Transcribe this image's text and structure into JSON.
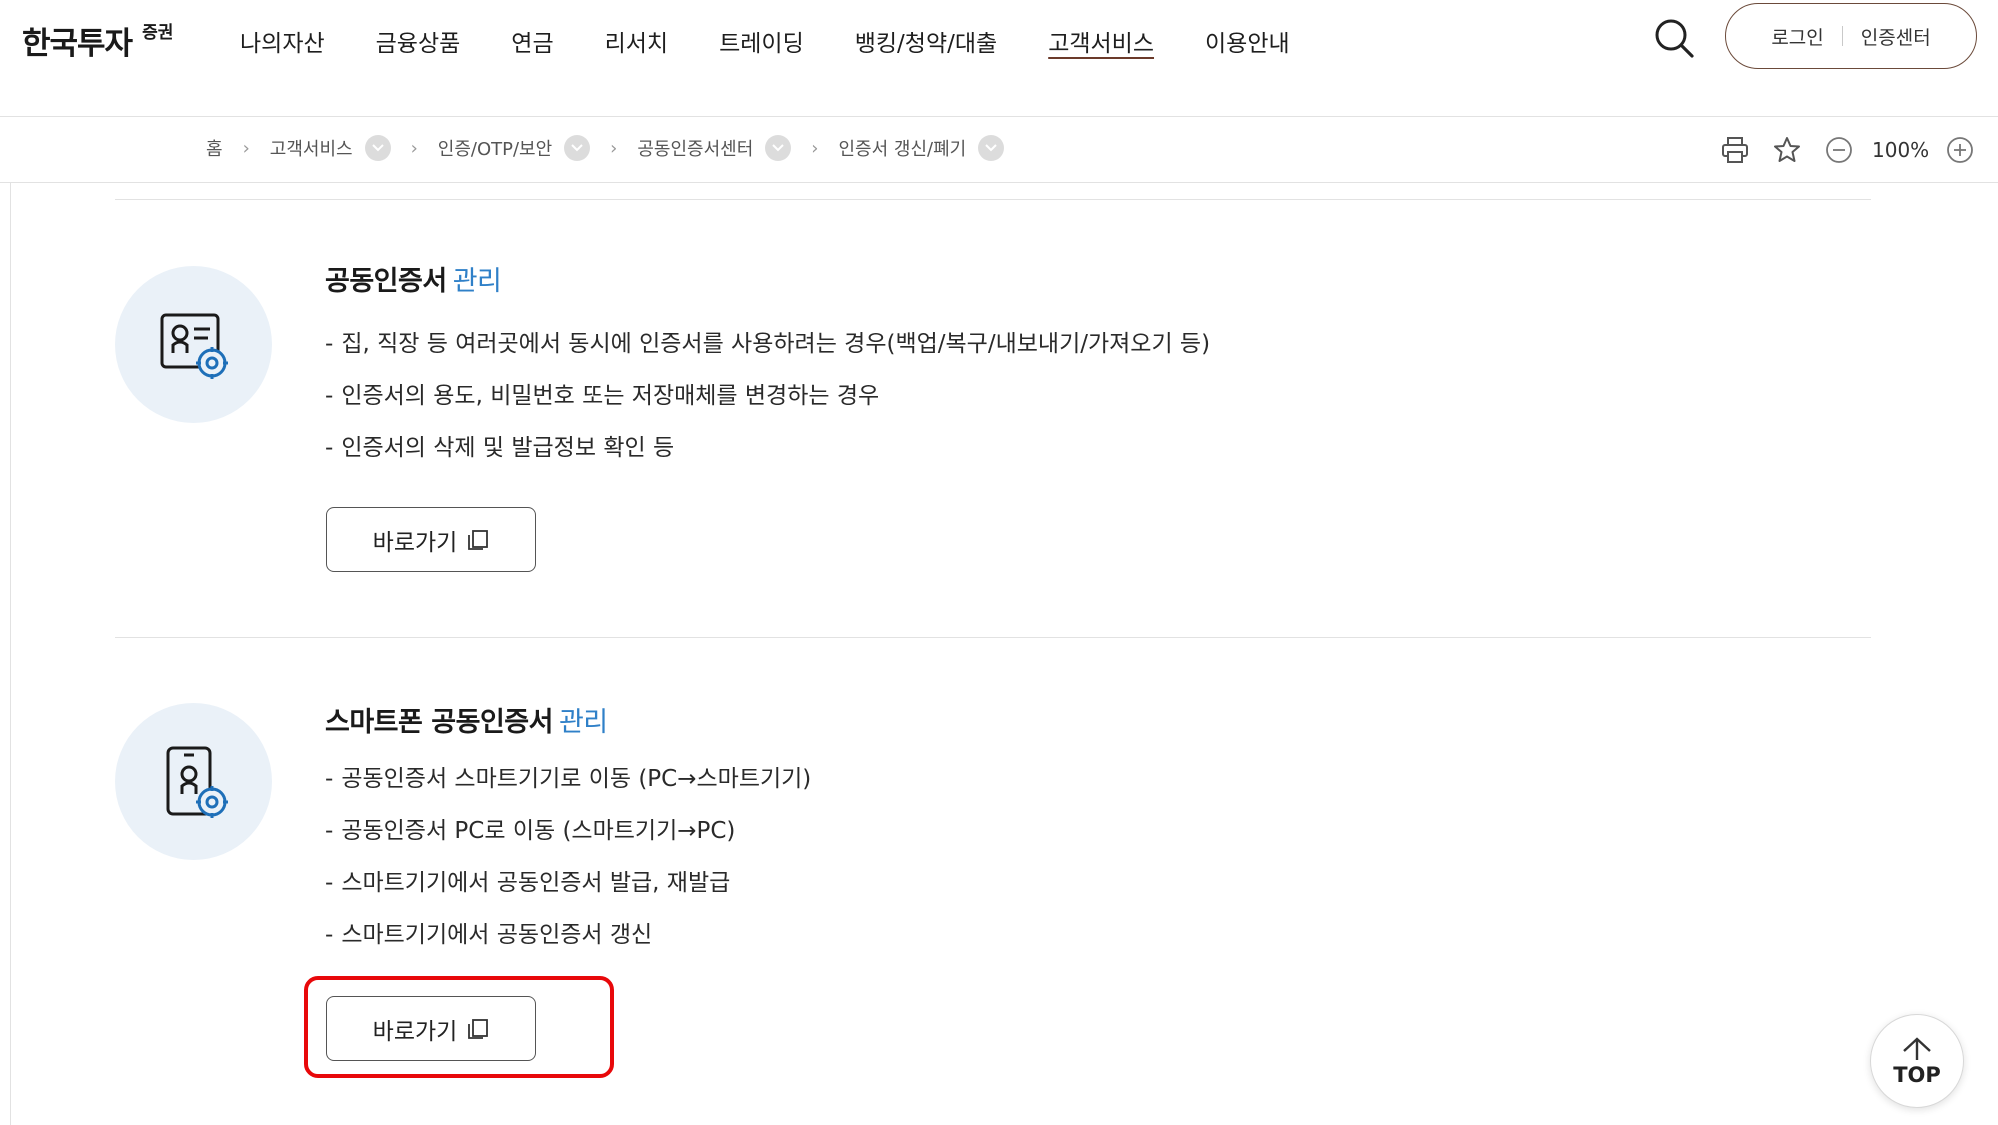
{
  "header": {
    "logo_main": "한국투자",
    "logo_sub": "증권",
    "nav": [
      {
        "label": "나의자산"
      },
      {
        "label": "금융상품"
      },
      {
        "label": "연금"
      },
      {
        "label": "리서치"
      },
      {
        "label": "트레이딩"
      },
      {
        "label": "뱅킹/청약/대출"
      },
      {
        "label": "고객서비스",
        "active": true
      },
      {
        "label": "이용안내"
      }
    ],
    "search_icon": "search-icon",
    "login_label": "로그인",
    "cert_center_label": "인증센터",
    "accent_color": "#6b4a3a"
  },
  "breadcrumb": {
    "home": "홈",
    "items": [
      "고객서비스",
      "인증/OTP/보안",
      "공동인증서센터",
      "인증서 갱신/폐기"
    ]
  },
  "tools": {
    "icons": [
      "print-icon",
      "star-icon",
      "zoom-out-icon",
      "zoom-in-icon"
    ],
    "zoom_level": "100%"
  },
  "sections": [
    {
      "title": "공동인증서",
      "title_accent": "관리",
      "icon": "certificate-gear-icon",
      "bullets": [
        "집, 직장 등 여러곳에서 동시에 인증서를 사용하려는 경우(백업/복구/내보내기/가져오기 등)",
        "인증서의 용도, 비밀번호 또는 저장매체를 변경하는 경우",
        "인증서의 삭제 및 발급정보 확인 등"
      ],
      "button": "바로가기"
    },
    {
      "title": "스마트폰 공동인증서",
      "title_accent": "관리",
      "icon": "smartphone-certificate-icon",
      "bullets": [
        "공동인증서 스마트기기로 이동 (PC→스마트기기)",
        "공동인증서 PC로 이동 (스마트기기→PC)",
        "스마트기기에서 공동인증서 발급, 재발급",
        "스마트기기에서 공동인증서 갱신"
      ],
      "button": "바로가기"
    }
  ],
  "top_button": "TOP",
  "colors": {
    "accent_blue": "#2f80c8",
    "icon_circle_bg": "#eaf1f8",
    "highlight_red": "#e8080a"
  }
}
